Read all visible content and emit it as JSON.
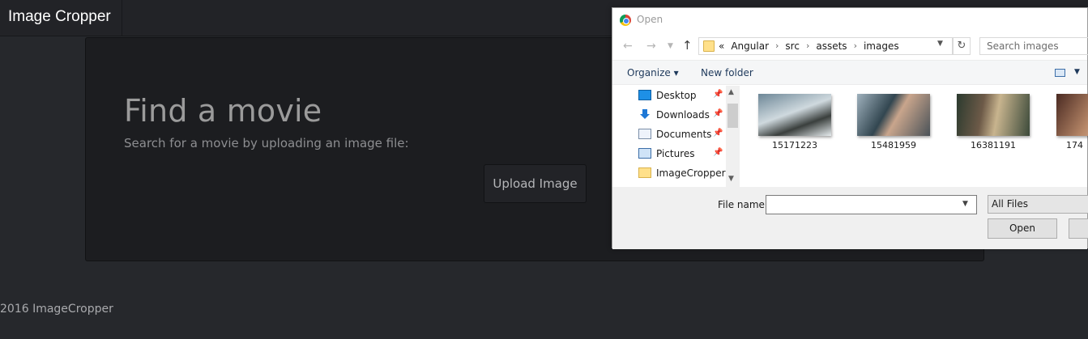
{
  "app": {
    "brand": "Image Cropper"
  },
  "hero": {
    "title": "Find a movie",
    "subtitle": "Search for a movie by uploading an image file:",
    "upload_label": "Upload Image"
  },
  "footer": {
    "text": "2016 ImageCropper"
  },
  "dialog": {
    "title": "Open",
    "breadcrumbs": [
      "«",
      "Angular",
      "src",
      "assets",
      "images"
    ],
    "search_placeholder": "Search images",
    "toolbar": {
      "organize": "Organize ▾",
      "new_folder": "New folder"
    },
    "nav_items": [
      {
        "label": "Desktop",
        "icon": "desktop-icon",
        "pinned": true
      },
      {
        "label": "Downloads",
        "icon": "downloads-icon",
        "pinned": true
      },
      {
        "label": "Documents",
        "icon": "documents-icon",
        "pinned": true
      },
      {
        "label": "Pictures",
        "icon": "pictures-icon",
        "pinned": true
      },
      {
        "label": "ImageCropper",
        "icon": "folder-icon",
        "pinned": false
      }
    ],
    "files": [
      {
        "name": "15171223"
      },
      {
        "name": "15481959"
      },
      {
        "name": "16381191"
      },
      {
        "name": "174"
      }
    ],
    "file_name_label": "File name:",
    "file_name_value": "",
    "file_type": "All Files",
    "open_button": "Open"
  }
}
